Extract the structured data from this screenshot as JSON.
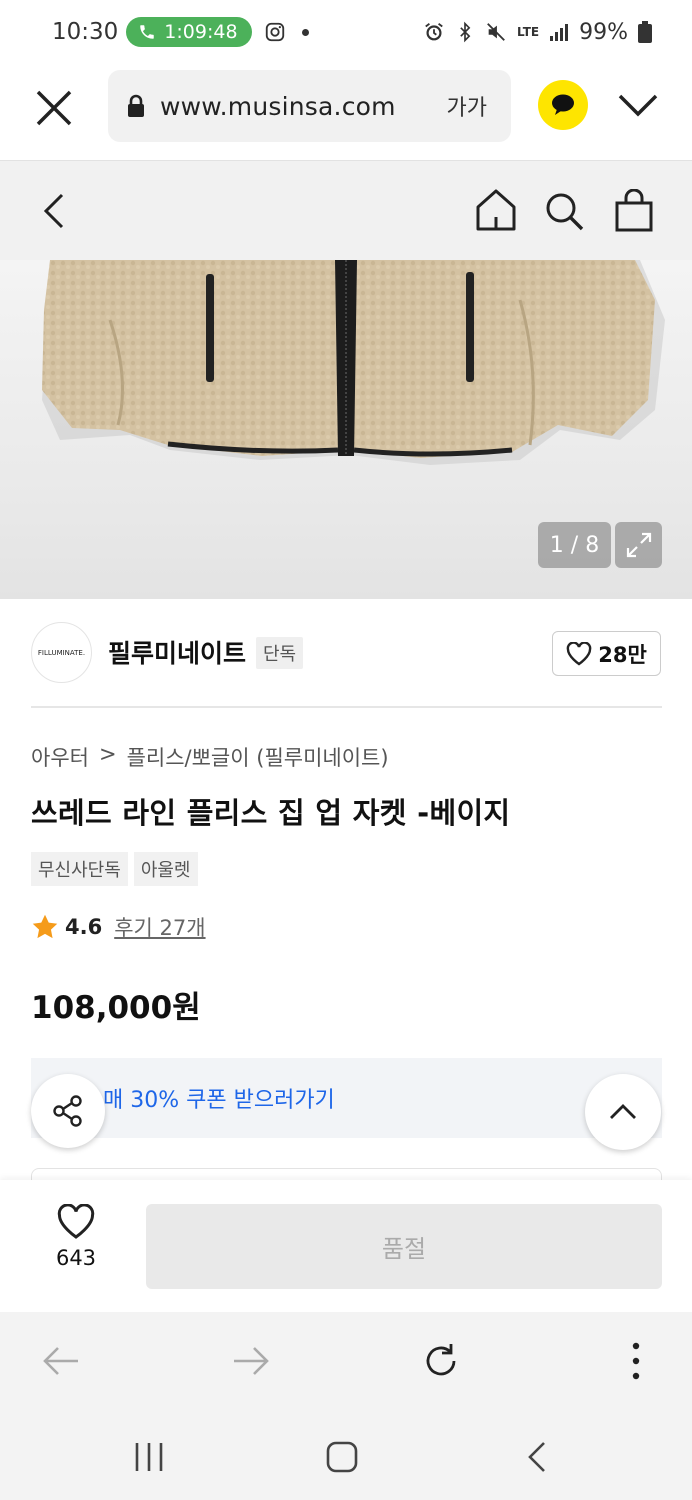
{
  "status_bar": {
    "time": "10:30",
    "call_duration": "1:09:48",
    "network": "LTE",
    "battery": "99%"
  },
  "browser": {
    "url": "www.musinsa.com",
    "text_size_label": "가가",
    "accent_color": "#fee500"
  },
  "gallery": {
    "counter": "1 / 8"
  },
  "brand": {
    "logo_text": "FILLUMINATE.",
    "name": "필루미네이트",
    "badge": "단독",
    "likes": "28만"
  },
  "product": {
    "breadcrumb": [
      "아우터",
      "플리스/뽀글이 (필루미네이트)"
    ],
    "breadcrumb_separator": ">",
    "title": "쓰레드 라인 플리스 집 업 자켓 -베이지",
    "tags": [
      "무신사단독",
      "아울렛"
    ],
    "rating": "4.6",
    "review_text": "후기 27개",
    "price": "108,000원",
    "coupon_text": "매 30% 쿠폰 받으러가기",
    "coupon_color": "#1e66e8",
    "star_color": "#f59b1a"
  },
  "purchase_bar": {
    "wish_count": "643",
    "button_label": "품절"
  }
}
